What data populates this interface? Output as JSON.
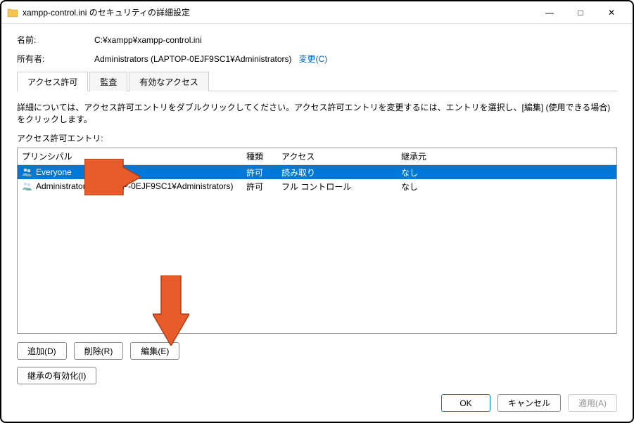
{
  "window": {
    "title": "xampp-control.ini のセキュリティの詳細設定",
    "minimize": "—",
    "maximize": "□",
    "close": "✕"
  },
  "meta": {
    "name_label": "名前:",
    "name_value": "C:¥xampp¥xampp-control.ini",
    "owner_label": "所有者:",
    "owner_value": "Administrators (LAPTOP-0EJF9SC1¥Administrators)",
    "change_link": "変更(C)"
  },
  "tabs": {
    "permissions": "アクセス許可",
    "audit": "監査",
    "effective": "有効なアクセス"
  },
  "help_text": "詳細については、アクセス許可エントリをダブルクリックしてください。アクセス許可エントリを変更するには、エントリを選択し、[編集] (使用できる場合) をクリックします。",
  "section_label": "アクセス許可エントリ:",
  "headers": {
    "principal": "プリンシパル",
    "type": "種類",
    "access": "アクセス",
    "inherited": "継承元"
  },
  "entries": [
    {
      "principal": "Everyone",
      "type": "許可",
      "access": "読み取り",
      "inherited": "なし"
    },
    {
      "principal": "Administrators (LAPTOP-0EJF9SC1¥Administrators)",
      "type": "許可",
      "access": "フル コントロール",
      "inherited": "なし"
    }
  ],
  "buttons": {
    "add": "追加(D)",
    "remove": "削除(R)",
    "edit": "編集(E)",
    "enable_inherit": "継承の有効化(I)",
    "ok": "OK",
    "cancel": "キャンセル",
    "apply": "適用(A)"
  },
  "icons": {
    "folder": "folder-icon",
    "users": "users-icon"
  }
}
